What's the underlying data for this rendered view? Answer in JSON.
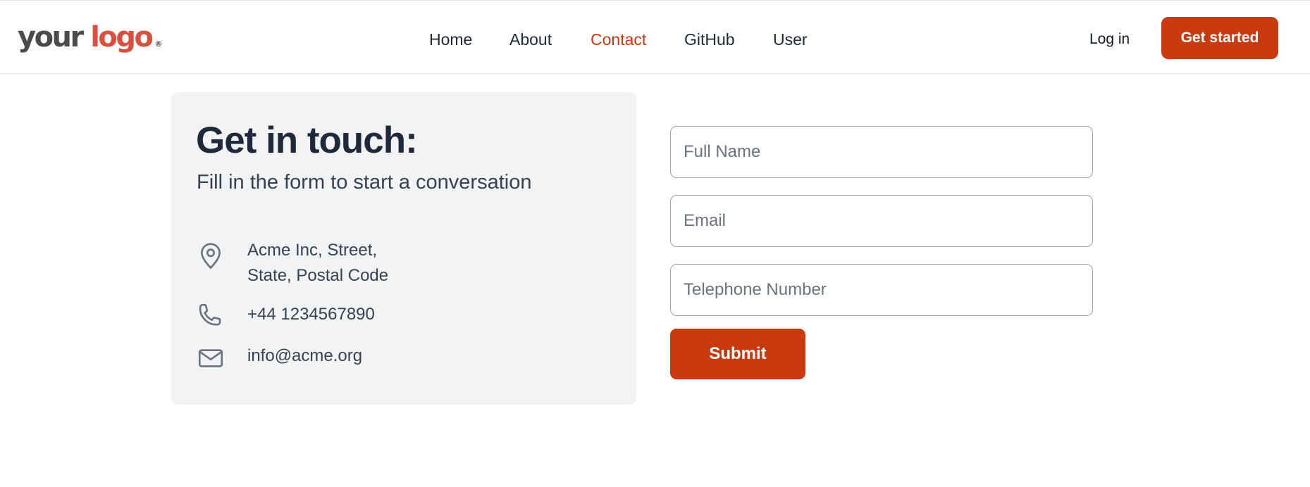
{
  "header": {
    "logo": {
      "word1": "your",
      "word2": "logo",
      "mark": "®"
    },
    "nav": [
      {
        "label": "Home",
        "active": false
      },
      {
        "label": "About",
        "active": false
      },
      {
        "label": "Contact",
        "active": true
      },
      {
        "label": "GitHub",
        "active": false
      },
      {
        "label": "User",
        "active": false
      }
    ],
    "login_label": "Log in",
    "cta_label": "Get started"
  },
  "contact_info": {
    "title": "Get in touch:",
    "subtitle": "Fill in the form to start a conversation",
    "address_line1": "Acme Inc, Street,",
    "address_line2": "State, Postal Code",
    "phone": "+44 1234567890",
    "email": "info@acme.org",
    "icons": {
      "address": "map-pin-icon",
      "phone": "phone-icon",
      "email": "mail-icon"
    }
  },
  "form": {
    "full_name": {
      "value": "",
      "placeholder": "Full Name"
    },
    "email": {
      "value": "",
      "placeholder": "Email"
    },
    "telephone": {
      "value": "",
      "placeholder": "Telephone Number"
    },
    "submit_label": "Submit"
  },
  "colors": {
    "accent": "#c93a0f",
    "logo_accent": "#d9503f",
    "card_bg": "#f2f3f5",
    "text_dark": "#1e293b"
  }
}
